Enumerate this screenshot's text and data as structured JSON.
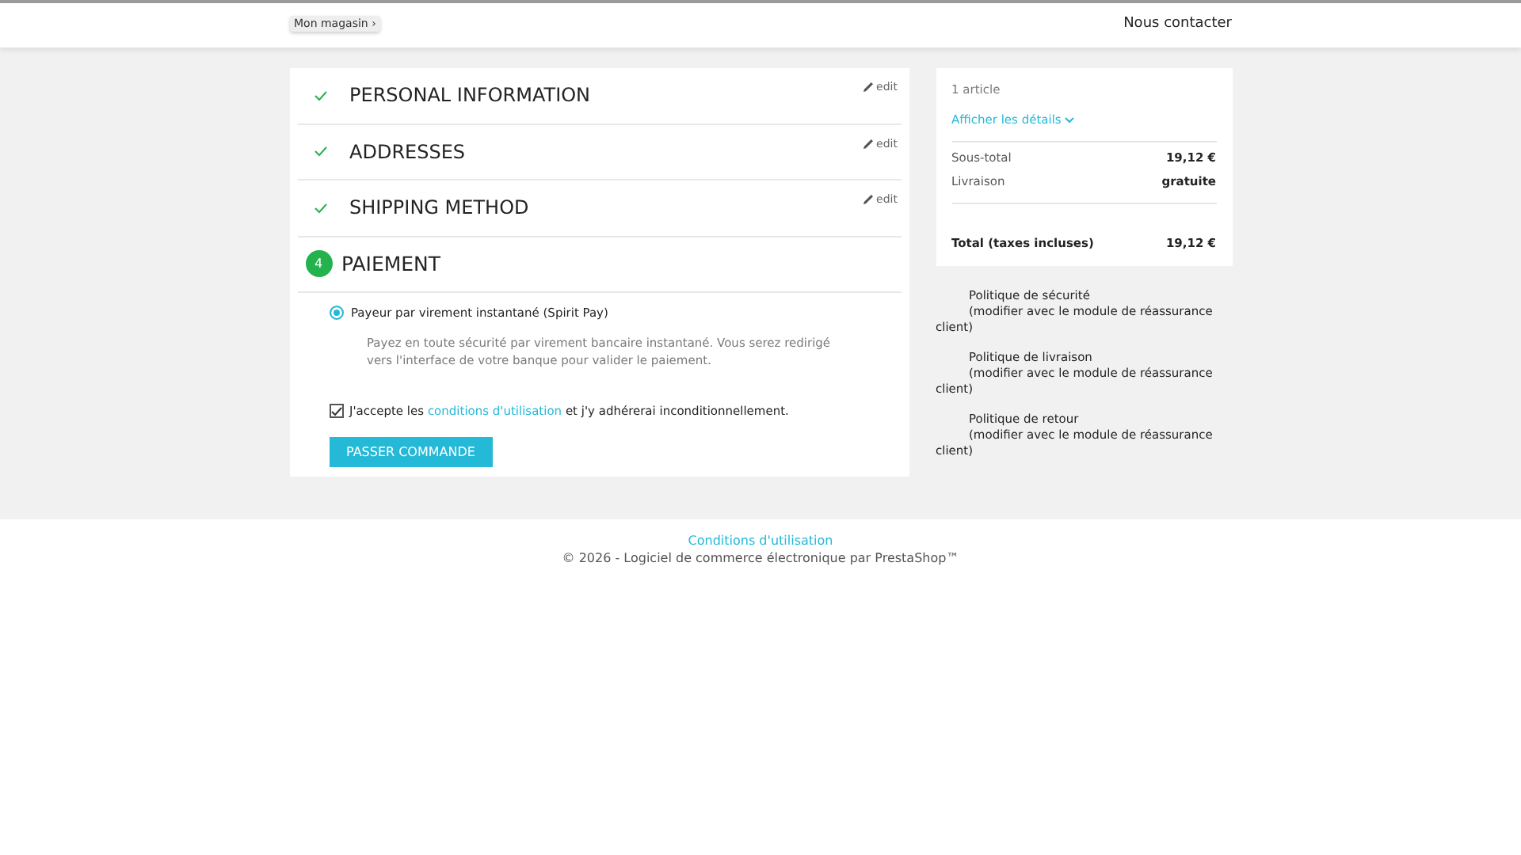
{
  "header": {
    "breadcrumb": "Mon magasin",
    "separator": "›",
    "contact": "Nous contacter"
  },
  "steps": [
    {
      "title": "PERSONAL INFORMATION",
      "kind": "done",
      "edit": "edit"
    },
    {
      "title": "ADDRESSES",
      "kind": "done",
      "edit": "edit"
    },
    {
      "title": "SHIPPING METHOD",
      "kind": "done",
      "edit": "edit"
    },
    {
      "title": "PAIEMENT",
      "kind": "current",
      "number": "4"
    }
  ],
  "payment": {
    "options": [
      {
        "label": "Payeur par virement instantané (Spirit Pay)",
        "selected": true,
        "description": "Payez en toute sécurité par virement bancaire instantané. Vous serez redirigé vers l'interface de votre banque pour valider le paiement."
      }
    ],
    "terms": {
      "checked": true,
      "before": "J'accepte les",
      "link": "conditions d'utilisation",
      "after": "et j'y adhérerai inconditionnellement."
    },
    "submit": "PASSER COMMANDE"
  },
  "summary": {
    "count": "1 article",
    "details": "Afficher les détails",
    "lines": [
      {
        "label": "Sous-total",
        "value": "19,12 €"
      },
      {
        "label": "Livraison",
        "value": "gratuite"
      }
    ],
    "total": {
      "label": "Total (taxes incluses)",
      "value": "19,12 €"
    }
  },
  "reassurance": [
    {
      "title": "Politique de sécurité",
      "note": "(modifier avec le module de réassurance client)"
    },
    {
      "title": "Politique de livraison",
      "note": "(modifier avec le module de réassurance client)"
    },
    {
      "title": "Politique de retour",
      "note": "(modifier avec le module de réassurance client)"
    }
  ],
  "footer": {
    "link": "Conditions d'utilisation",
    "copyright": "© 2026 - Logiciel de commerce électronique par PrestaShop™"
  }
}
